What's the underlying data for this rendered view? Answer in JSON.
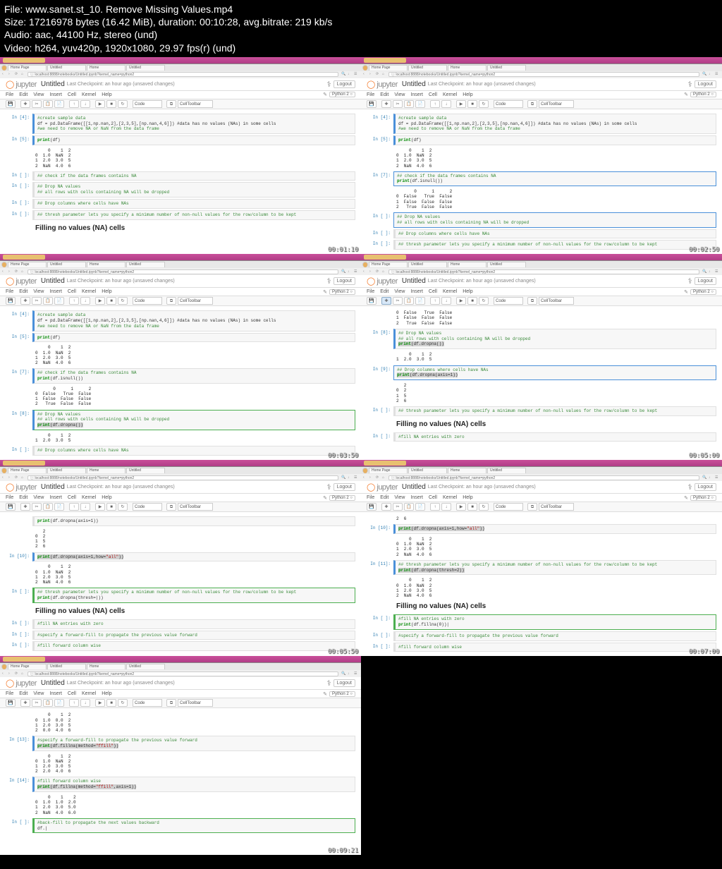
{
  "file_info": {
    "line1": "File: www.sanet.st_10. Remove Missing Values.mp4",
    "line2": "Size: 17216978 bytes (16.42 MiB), duration: 00:10:28, avg.bitrate: 219 kb/s",
    "line3": "Audio: aac, 44100 Hz, stereo (und)",
    "line4": "Video: h264, yuv420p, 1920x1080, 29.97 fps(r) (und)"
  },
  "common": {
    "jupyter": "jupyter",
    "title": "Untitled",
    "checkpoint": "Last Checkpoint: an hour ago (unsaved changes)",
    "logout": "Logout",
    "menu": [
      "File",
      "Edit",
      "View",
      "Insert",
      "Cell",
      "Kernel",
      "Help"
    ],
    "kernel": "Python 2",
    "celltype": "Code",
    "celltoolbar": "CellToolbar",
    "url": "localhost:8888/notebooks/Untitled.ipynb?kernel_name=python2",
    "tab_names": [
      "Home Page",
      "Untitled",
      "Home",
      "Untitled"
    ],
    "fill_heading": "Filling no values (NA) cells"
  },
  "timestamps": [
    "00:01:10",
    "00:02:50",
    "00:03:50",
    "00:05:00",
    "00:05:50",
    "00:07:00",
    "00:09:21"
  ],
  "panes": [
    {
      "cells": [
        {
          "prompt": "In [4]:",
          "ran": true,
          "code": [
            "#create sample data",
            "df = pd.DataFrame([[1,np.nan,2],[2,3,5],[np.nan,4,6]]) #data has no values (NAs) in some cells",
            "#we need to remove NA or NaN from the data frame"
          ]
        },
        {
          "prompt": "In [5]:",
          "ran": true,
          "code": [
            "print(df)"
          ],
          "output": "     0    1  2\n0  1.0  NaN  2\n1  2.0  3.0  5\n2  NaN  4.0  6"
        },
        {
          "prompt": "In [ ]:",
          "code": [
            "## check if the data frames contains NA"
          ],
          "cursor": true
        },
        {
          "prompt": "In [ ]:",
          "code": [
            "## Drop NA values",
            "## all rows with cells containing NA will be dropped"
          ]
        },
        {
          "prompt": "In [ ]:",
          "code": [
            "## Drop columns where cells have NAs"
          ]
        },
        {
          "prompt": "In [ ]:",
          "code": [
            "## thresh parameter lets you specify a minimum number of non-null values for the row/column to be kept"
          ]
        },
        {
          "md": true,
          "heading": "Filling no values (NA) cells"
        }
      ]
    },
    {
      "cells": [
        {
          "prompt": "In [4]:",
          "ran": true,
          "code": [
            "#create sample data",
            "df = pd.DataFrame([[1,np.nan,2],[2,3,5],[np.nan,4,6]]) #data has no values (NAs) in some cells",
            "#we need to remove NA or NaN from the data frame"
          ]
        },
        {
          "prompt": "In [5]:",
          "ran": true,
          "code": [
            "print(df)"
          ],
          "output": "     0    1  2\n0  1.0  NaN  2\n1  2.0  3.0  5\n2  NaN  4.0  6"
        },
        {
          "prompt": "In [7]:",
          "ran": true,
          "active": true,
          "code": [
            "## check if the data frames contains NA",
            "print(df.isnull())"
          ],
          "output": "       0      1      2\n0  False   True  False\n1  False  False  False\n2   True  False  False"
        },
        {
          "prompt": "In [ ]:",
          "active": true,
          "code": [
            "## Drop NA values",
            "## all rows with cells containing NA will be dropped"
          ]
        },
        {
          "prompt": "In [ ]:",
          "code": [
            "## Drop columns where cells have NAs"
          ]
        },
        {
          "prompt": "In [ ]:",
          "code": [
            "## thresh parameter lets you specify a minimum number of non-null values for the row/column to be kept"
          ]
        }
      ]
    },
    {
      "cells": [
        {
          "prompt": "In [4]:",
          "ran": true,
          "code": [
            "#create sample data",
            "df = pd.DataFrame([[1,np.nan,2],[2,3,5],[np.nan,4,6]]) #data has no values (NAs) in some cells",
            "#we need to remove NA or NaN from the data frame"
          ]
        },
        {
          "prompt": "In [5]:",
          "ran": true,
          "code": [
            "print(df)"
          ],
          "output": "     0    1  2\n0  1.0  NaN  2\n1  2.0  3.0  5\n2  NaN  4.0  6"
        },
        {
          "prompt": "In [7]:",
          "ran": true,
          "code": [
            "## check if the data frames contains NA",
            "print(df.isnull())"
          ],
          "output": "       0      1      2\n0  False   True  False\n1  False  False  False\n2   True  False  False"
        },
        {
          "prompt": "In [8]:",
          "ran": true,
          "active_green": true,
          "code": [
            "## Drop NA values",
            "## all rows with cells containing NA will be dropped",
            "print(df.dropna())"
          ],
          "hl_line": 2,
          "output": "     0    1  2\n1  2.0  3.0  5"
        },
        {
          "prompt": "In [ ]:",
          "code": [
            "## Drop columns where cells have NAs"
          ]
        }
      ]
    },
    {
      "tool_active": true,
      "cells": [
        {
          "output_only": true,
          "output": "0  False   True  False\n1  False  False  False\n2   True  False  False"
        },
        {
          "prompt": "In [8]:",
          "ran": true,
          "code": [
            "## Drop NA values",
            "## all rows with cells containing NA will be dropped",
            "print(df.dropna())"
          ],
          "hl_line": 2,
          "output": "     0    1  2\n1  2.0  3.0  5"
        },
        {
          "prompt": "In [9]:",
          "ran": true,
          "active": true,
          "code": [
            "## Drop columns where cells have NAs",
            "print(df.dropna(axis=1))"
          ],
          "hl_line": 1,
          "output": "   2\n0  2\n1  5\n2  6"
        },
        {
          "prompt": "In [ ]:",
          "code": [
            "## thresh parameter lets you specify a minimum number of non-null values for the row/column to be kept"
          ]
        },
        {
          "md": true,
          "heading": "Filling no values (NA) cells"
        },
        {
          "prompt": "In [ ]:",
          "code": [
            "#fill NA entries with zero"
          ]
        }
      ]
    },
    {
      "cells": [
        {
          "output_only": true,
          "indent": true,
          "code": [
            "print(df.dropna(axis=1))"
          ],
          "output": "   2\n0  2\n1  5\n2  6"
        },
        {
          "prompt": "In [10]:",
          "ran": true,
          "code": [
            "print(df.dropna(axis=1,how=\"all\"))"
          ],
          "hl_line": 0,
          "output": "     0    1  2\n0  1.0  NaN  2\n1  2.0  3.0  5\n2  NaN  4.0  6"
        },
        {
          "prompt": "In [ ]:",
          "active_green": true,
          "code": [
            "## thresh parameter lets you specify a minimum number of non-null values for the row/column to be kept",
            "print(df.dropna(thresh=|))"
          ]
        },
        {
          "md": true,
          "heading": "Filling no values (NA) cells"
        },
        {
          "prompt": "In [ ]:",
          "code": [
            "#fill NA entries with zero"
          ]
        },
        {
          "prompt": "In [ ]:",
          "code": [
            "#specify a forward-fill to propagate the previous value forward"
          ]
        },
        {
          "prompt": "In [ ]:",
          "code": [
            "#fill forward column wise"
          ]
        }
      ]
    },
    {
      "cells": [
        {
          "output_only": true,
          "output": "2  6"
        },
        {
          "prompt": "In [10]:",
          "ran": true,
          "code": [
            "print(df.dropna(axis=1,how=\"all\"))"
          ],
          "hl_line": 0,
          "output": "     0    1  2\n0  1.0  NaN  2\n1  2.0  3.0  5\n2  NaN  4.0  6"
        },
        {
          "prompt": "In [11]:",
          "ran": true,
          "code": [
            "## thresh parameter lets you specify a minimum number of non-null values for the row/column to be kept",
            "print(df.dropna(thresh=2))"
          ],
          "hl_line": 1,
          "output": "     0    1  2\n0  1.0  NaN  2\n1  2.0  3.0  5\n2  NaN  4.0  6"
        },
        {
          "md": true,
          "heading": "Filling no values (NA) cells"
        },
        {
          "prompt": "In [ ]:",
          "active_green": true,
          "code": [
            "#fill NA entries with zero",
            "print(df.fillna(0))|"
          ]
        },
        {
          "prompt": "In [ ]:",
          "code": [
            "#specify a forward-fill to propagate the previous value forward"
          ]
        },
        {
          "prompt": "In [ ]:",
          "code": [
            "#fill forward column wise"
          ]
        }
      ]
    },
    {
      "cells": [
        {
          "output_only": true,
          "output": "     0    1  2\n0  1.0  0.0  2\n1  2.0  3.0  5\n2  0.0  4.0  6"
        },
        {
          "prompt": "In [13]:",
          "ran": true,
          "code": [
            "#specify a forward-fill to propagate the previous value forward",
            "print(df.fillna(method=\"ffill\"))"
          ],
          "hl_line": 1,
          "output": "     0    1  2\n0  1.0  NaN  2\n1  2.0  3.0  5\n2  2.0  4.0  6"
        },
        {
          "prompt": "In [14]:",
          "ran": true,
          "code": [
            "#fill forward column wise",
            "print(df.fillna(method=\"ffill\",axis=1))"
          ],
          "hl_line": 1,
          "output": "     0    1    2\n0  1.0  1.0  2.0\n1  2.0  3.0  5.0\n2  NaN  4.0  6.0"
        },
        {
          "prompt": "In [ ]:",
          "active_green": true,
          "code": [
            "#back-fill to propagate the next values backward",
            "df.|"
          ]
        }
      ]
    }
  ]
}
